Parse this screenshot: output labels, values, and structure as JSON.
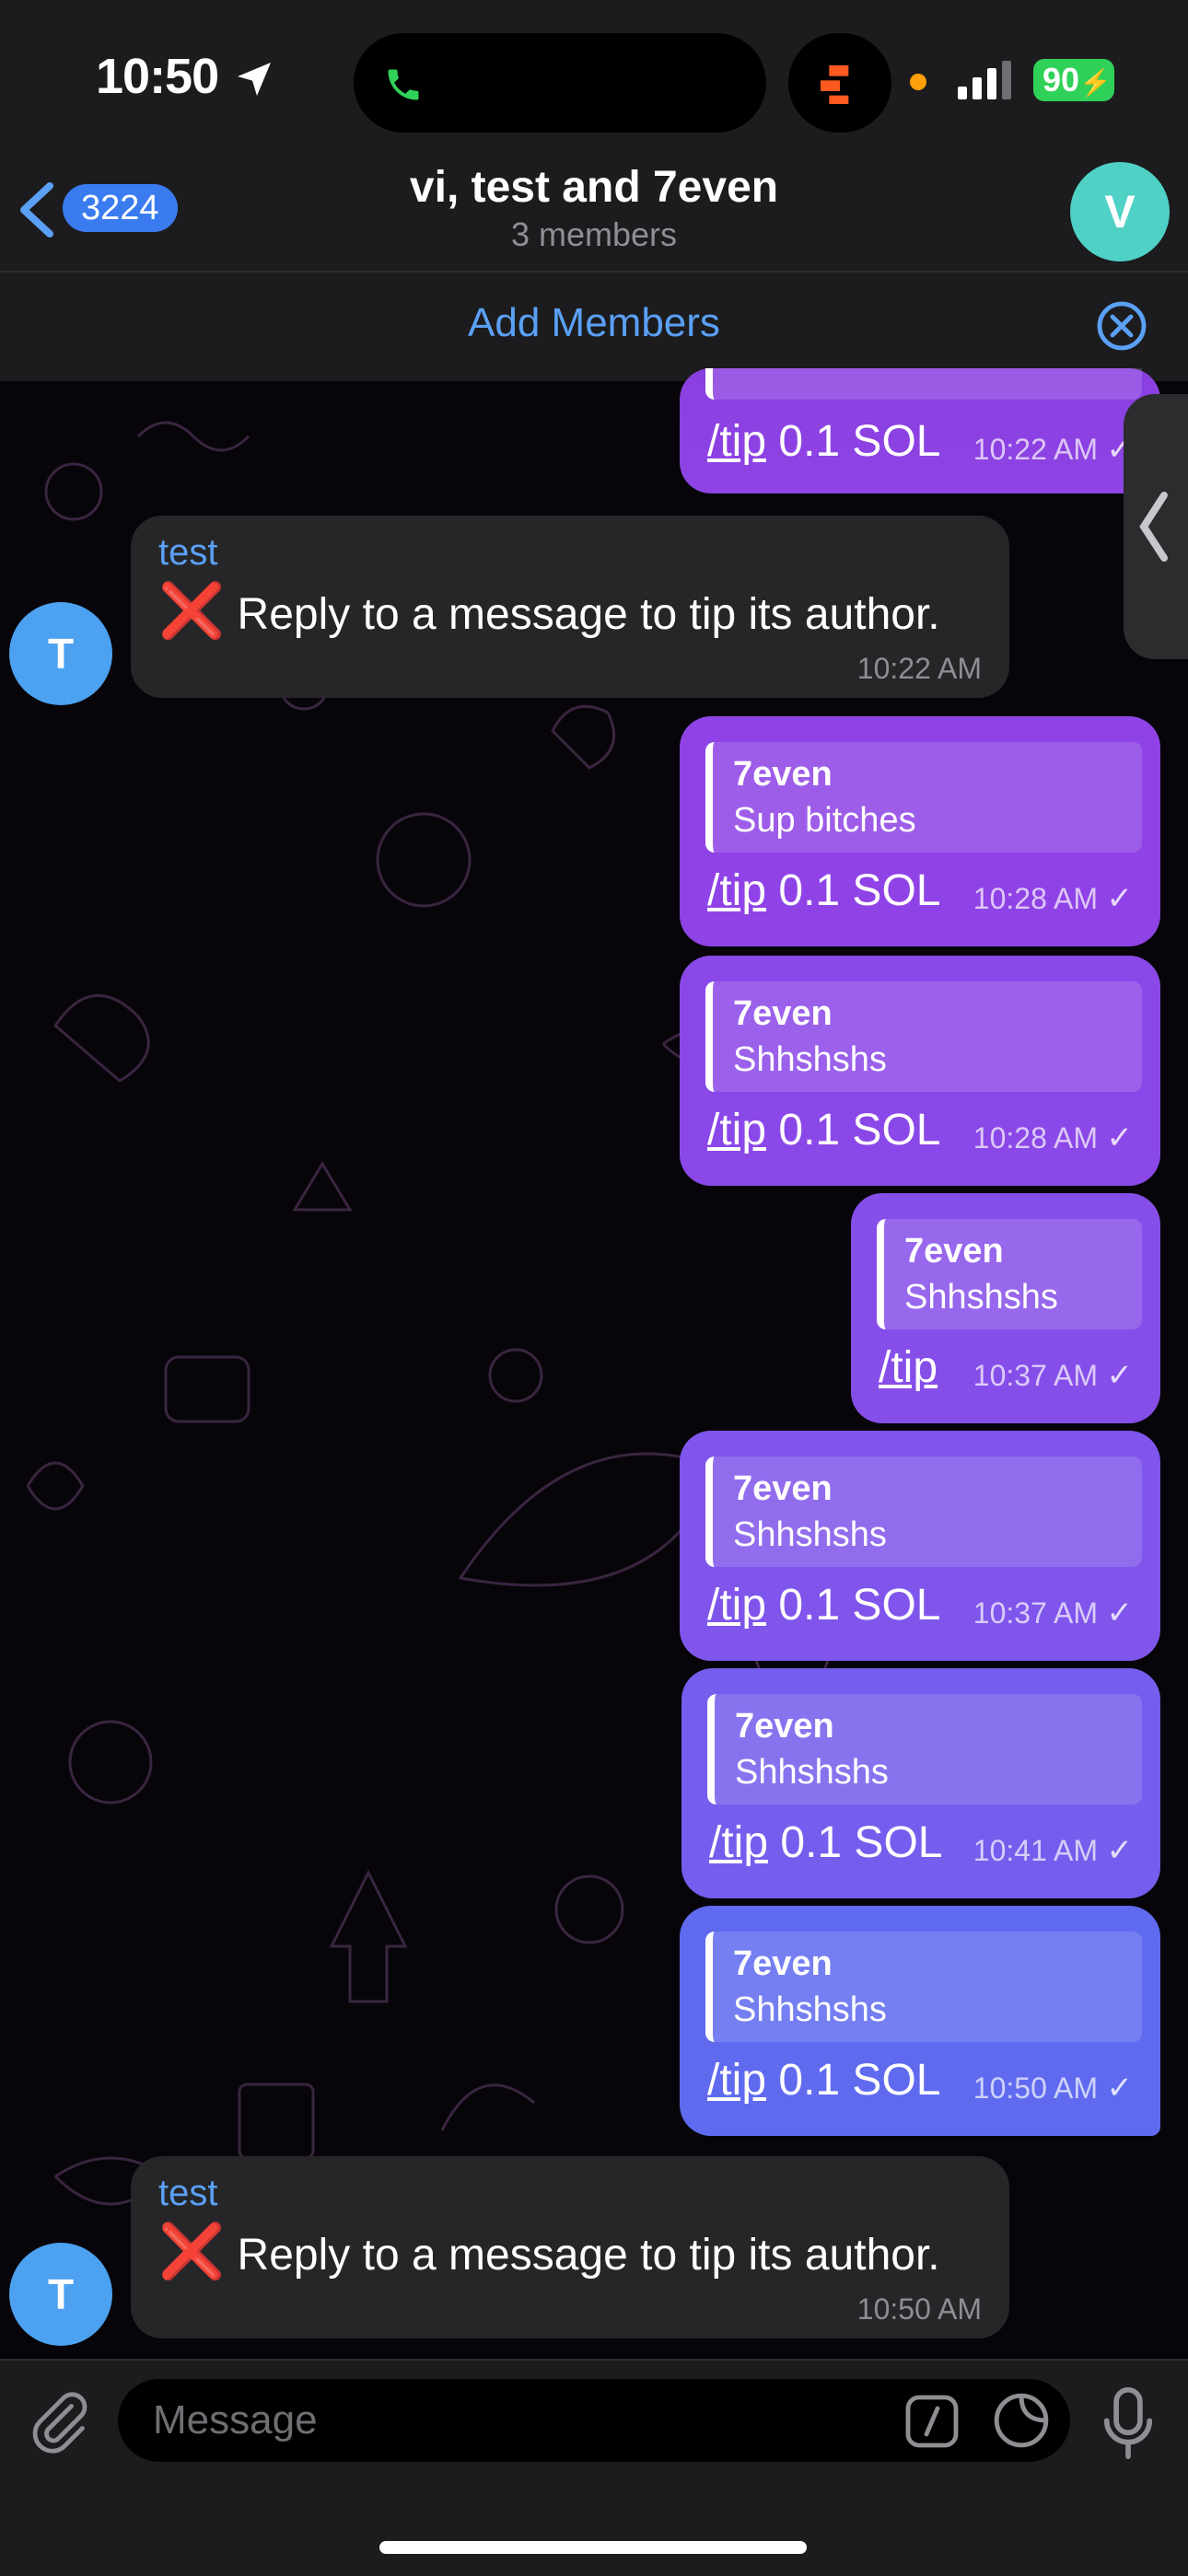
{
  "status_bar": {
    "time": "10:50",
    "battery": "90"
  },
  "header": {
    "back_count": "3224",
    "title": "vi, test and 7even",
    "subtitle": "3 members",
    "avatar_letter": "V",
    "add_members_label": "Add Members"
  },
  "messages": {
    "top_partial": {
      "text_cmd": "/tip",
      "text_rest": " 0.1 SOL",
      "time": "10:22 AM",
      "check": "✓"
    },
    "in1": {
      "sender": "test",
      "icon": "❌",
      "text": " Reply to a message to tip its author.",
      "time": "10:22 AM",
      "avatar": "T"
    },
    "out1": {
      "quote_name": "7even",
      "quote_text": "Sup bitches",
      "cmd": "/tip",
      "rest": " 0.1 SOL",
      "time": "10:28 AM",
      "check": "✓"
    },
    "out2": {
      "quote_name": "7even",
      "quote_text": "Shhshshs",
      "cmd": "/tip",
      "rest": " 0.1 SOL",
      "time": "10:28 AM",
      "check": "✓"
    },
    "out3": {
      "quote_name": "7even",
      "quote_text": "Shhshshs",
      "cmd": "/tip",
      "rest": "",
      "time": "10:37 AM",
      "check": "✓"
    },
    "out4": {
      "quote_name": "7even",
      "quote_text": "Shhshshs",
      "cmd": "/tip",
      "rest": " 0.1 SOL",
      "time": "10:37 AM",
      "check": "✓"
    },
    "out5": {
      "quote_name": "7even",
      "quote_text": "Shhshshs",
      "cmd": "/tip",
      "rest": " 0.1 SOL",
      "time": "10:41 AM",
      "check": "✓"
    },
    "out6": {
      "quote_name": "7even",
      "quote_text": "Shhshshs",
      "cmd": "/tip",
      "rest": " 0.1 SOL",
      "time": "10:50 AM",
      "check": "✓"
    },
    "in2": {
      "sender": "test",
      "icon": "❌",
      "text": " Reply to a message to tip its author.",
      "time": "10:50 AM",
      "avatar": "T"
    }
  },
  "composer": {
    "placeholder": "Message"
  },
  "colors": {
    "accent": "#5aa0f5",
    "bubble_purple": "#8c4ce6",
    "bubble_blue": "#5b6cf0",
    "incoming": "#262628"
  }
}
